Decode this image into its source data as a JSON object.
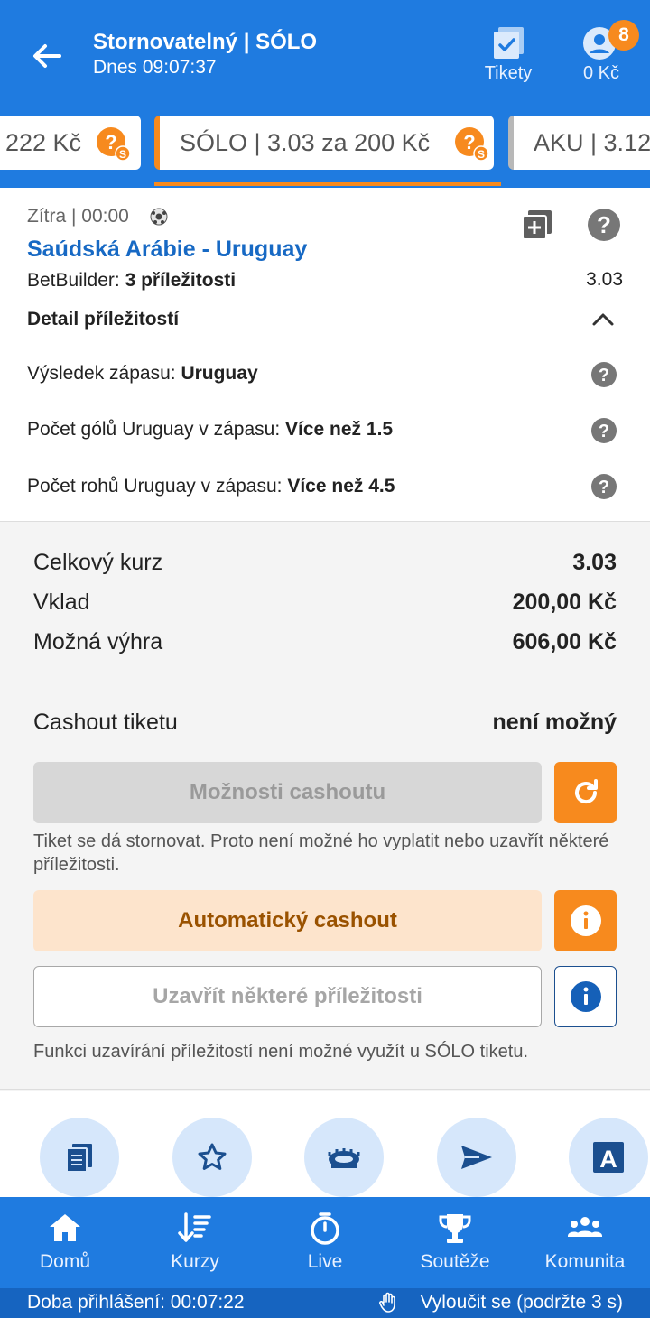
{
  "header": {
    "title": "Stornovatelný | SÓLO",
    "subtitle": "Dnes 09:07:37",
    "tickets_label": "Tikety",
    "balance": "0 Kč",
    "notification_count": "8",
    "accent_color": "#1f7be0"
  },
  "tabs": [
    {
      "label": "222 Kč"
    },
    {
      "label": "SÓLO  | 3.03 za 200 Kč"
    },
    {
      "label": "AKU  | 3.12"
    }
  ],
  "event": {
    "when": "Zítra  | 00:00",
    "match": "Saúdská Arábie - Uruguay",
    "betbuilder_prefix": "BetBuilder: ",
    "betbuilder_value": "3 příležitosti",
    "odds": "3.03",
    "detail_heading": "Detail příležitostí",
    "selections": [
      {
        "market": "Výsledek zápasu: ",
        "pick": "Uruguay"
      },
      {
        "market": "Počet gólů Uruguay v zápasu: ",
        "pick": "Více než 1.5"
      },
      {
        "market": "Počet rohů Uruguay v zápasu: ",
        "pick": "Více než 4.5"
      }
    ]
  },
  "summary": {
    "total_odds_label": "Celkový kurz",
    "total_odds": "3.03",
    "stake_label": "Vklad",
    "stake": "200,00 Kč",
    "win_label": "Možná výhra",
    "win": "606,00 Kč",
    "cashout_label": "Cashout tiketu",
    "cashout_status": "není možný",
    "cashout_options_button": "Možnosti cashoutu",
    "storno_note": "Tiket se dá stornovat. Proto není možné ho vyplatit nebo uzavřít některé příležitosti.",
    "auto_cashout_button": "Automatický cashout",
    "close_selections_button": "Uzavřít některé příležitosti",
    "close_note": "Funkci uzavírání příležitostí není možné využít u SÓLO tiketu.",
    "orange_color": "#f78a1e"
  },
  "shortcuts": [
    "ticket-list-icon",
    "star-icon",
    "stadium-icon",
    "send-icon",
    "font-size-icon"
  ],
  "bottom_nav": [
    {
      "label": "Domů",
      "icon": "home-icon"
    },
    {
      "label": "Kurzy",
      "icon": "odds-icon"
    },
    {
      "label": "Live",
      "icon": "stopwatch-icon"
    },
    {
      "label": "Soutěže",
      "icon": "trophy-icon"
    },
    {
      "label": "Komunita",
      "icon": "community-icon"
    }
  ],
  "status_bar": {
    "login_time": "Doba přihlášení: 00:07:22",
    "self_exclude": "Vyloučit se (podržte 3 s)"
  }
}
